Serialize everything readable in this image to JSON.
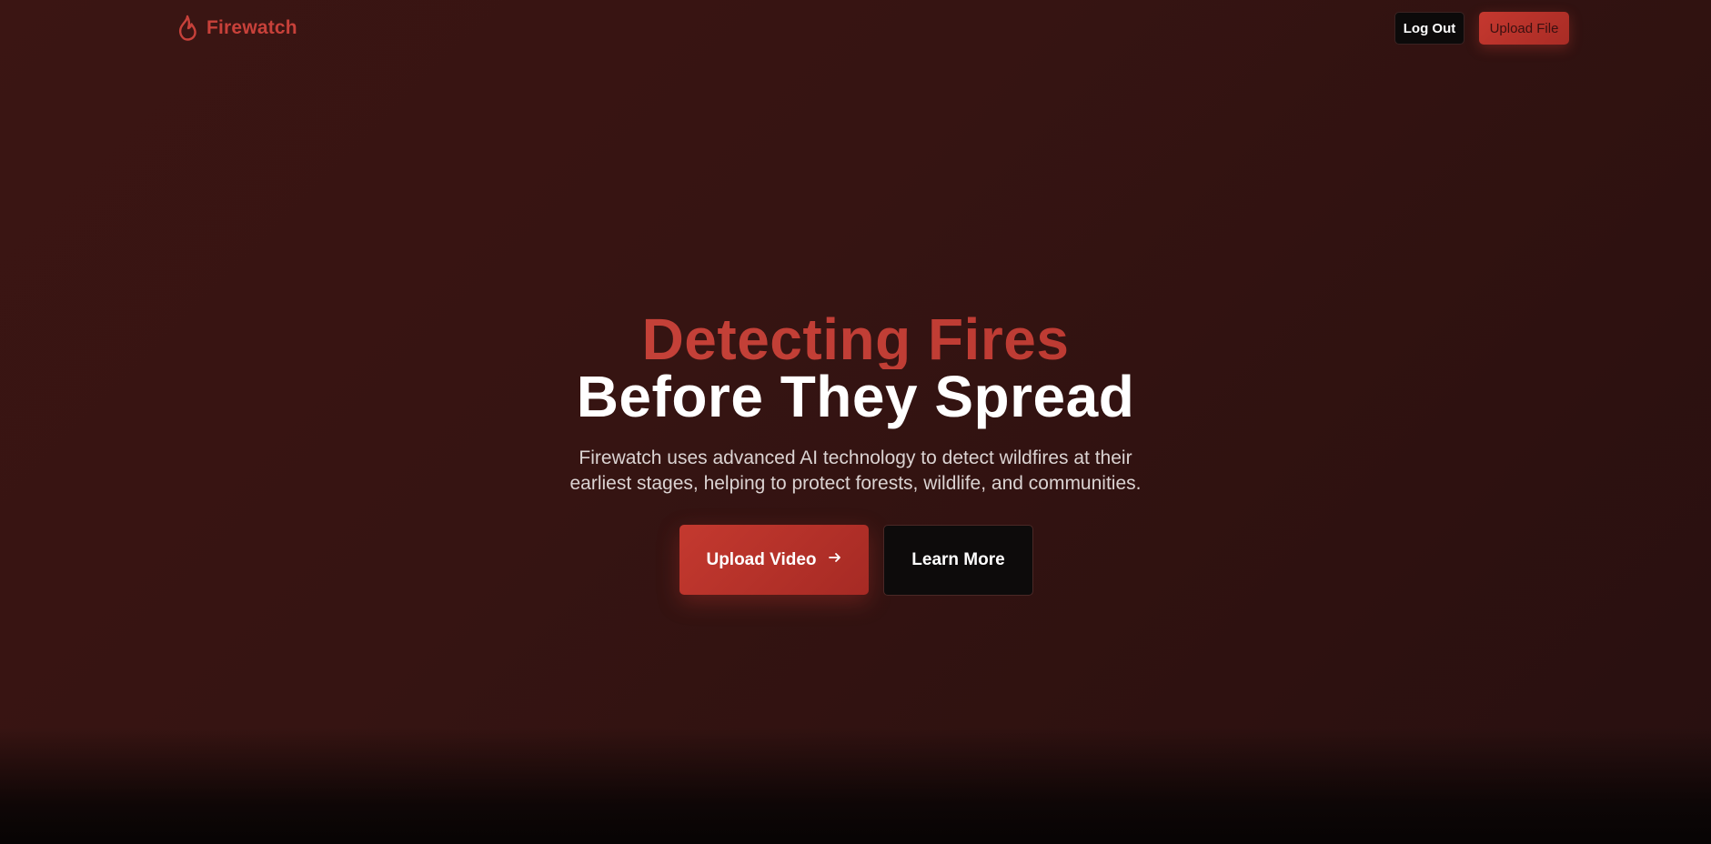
{
  "header": {
    "brand_name": "Firewatch",
    "brand_icon": "flame-icon",
    "logout_label": "Log Out",
    "upload_file_label": "Upload File"
  },
  "hero": {
    "headline_accent": "Detecting Fires",
    "headline_main": "Before They Spread",
    "subtitle": "Firewatch uses advanced AI technology to detect wildfires at their earliest stages, helping to protect forests, wildlife, and communities.",
    "primary_cta_label": "Upload Video",
    "primary_cta_icon": "arrow-right-icon",
    "secondary_cta_label": "Learn More"
  },
  "colors": {
    "accent": "#c8413a",
    "background": "#3a1513",
    "button_dark": "#0c0a0a",
    "text_light": "#dbd3d2"
  }
}
